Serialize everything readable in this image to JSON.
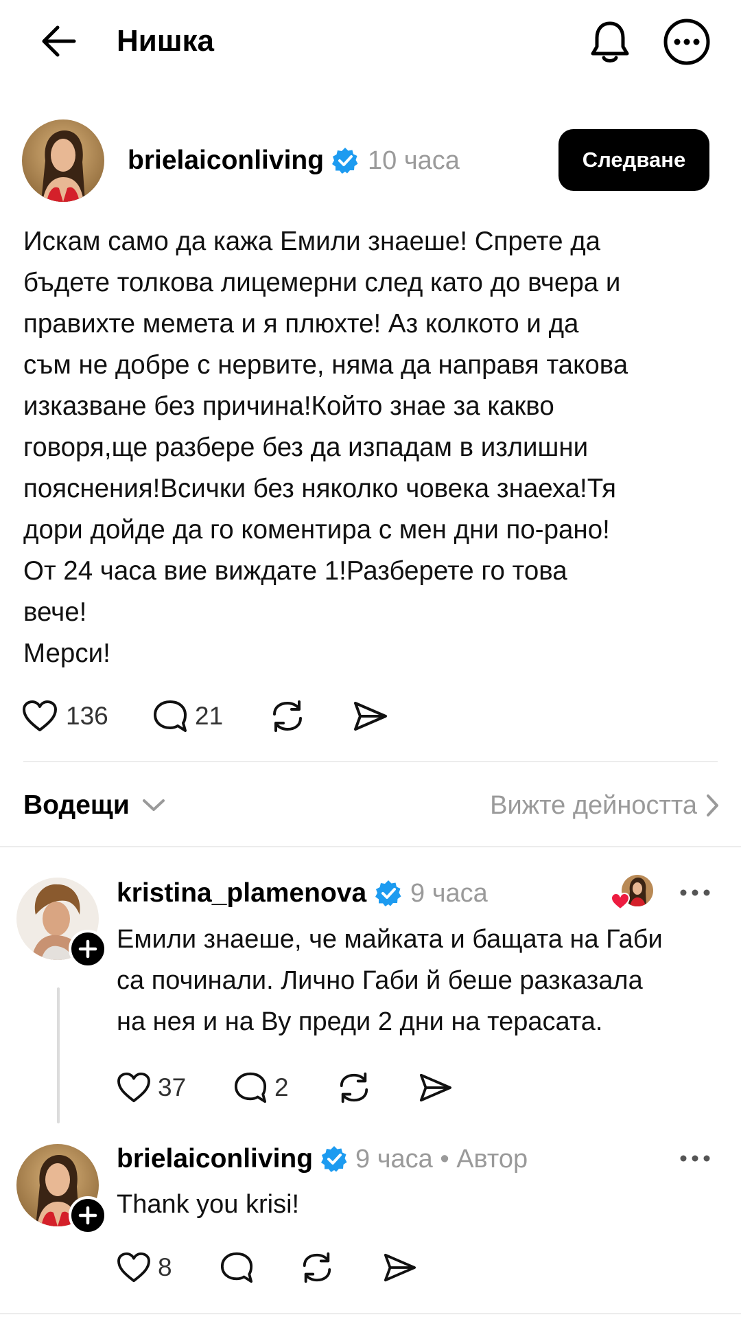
{
  "header": {
    "title": "Нишка",
    "back_icon": "arrow-left-icon",
    "bell_icon": "bell-icon",
    "more_icon": "more-circle-icon"
  },
  "post": {
    "username": "brielaiconliving",
    "verified": true,
    "time": "10 часа",
    "follow_label": "Следване",
    "text": "Искам само да кажа Емили знаеше! Спрете да\nбъдете толкова лицемерни след като до вчера и\nправихте мемета и я плюхте! Аз колкото и да\nсъм не добре с нервите, няма да направя такова\nизказване без причина!Който знае за какво\nговоря,ще разбере без да изпадам в излишни\nпояснения!Всички без няколко човека знаеха!Тя\nдори дойде да го коментира с мен дни по-рано!\nОт 24 часа вие виждате 1!Разберете го това\nвече!\nМерси!",
    "likes": "136",
    "comments": "21"
  },
  "replies_section": {
    "title": "Водещи",
    "activity_link": "Вижте дейността"
  },
  "replies": [
    {
      "username": "kristina_plamenova",
      "verified": true,
      "time": "9 часа",
      "text": "Емили знаеше, че майката и бащата на Габи\nса починали. Лично Габи й беше разказала\nна нея и на Ву преди 2 дни на терасата.",
      "likes": "37",
      "comments": "2"
    },
    {
      "username": "brielaiconliving",
      "verified": true,
      "time": "9 часа",
      "author_tag": "• Автор",
      "text": "Thank you krisi!",
      "likes": "8"
    }
  ],
  "colors": {
    "verified_blue": "#1d9bf0",
    "like_heart_red": "#ed1c40",
    "muted_text": "#9a9a9a"
  }
}
